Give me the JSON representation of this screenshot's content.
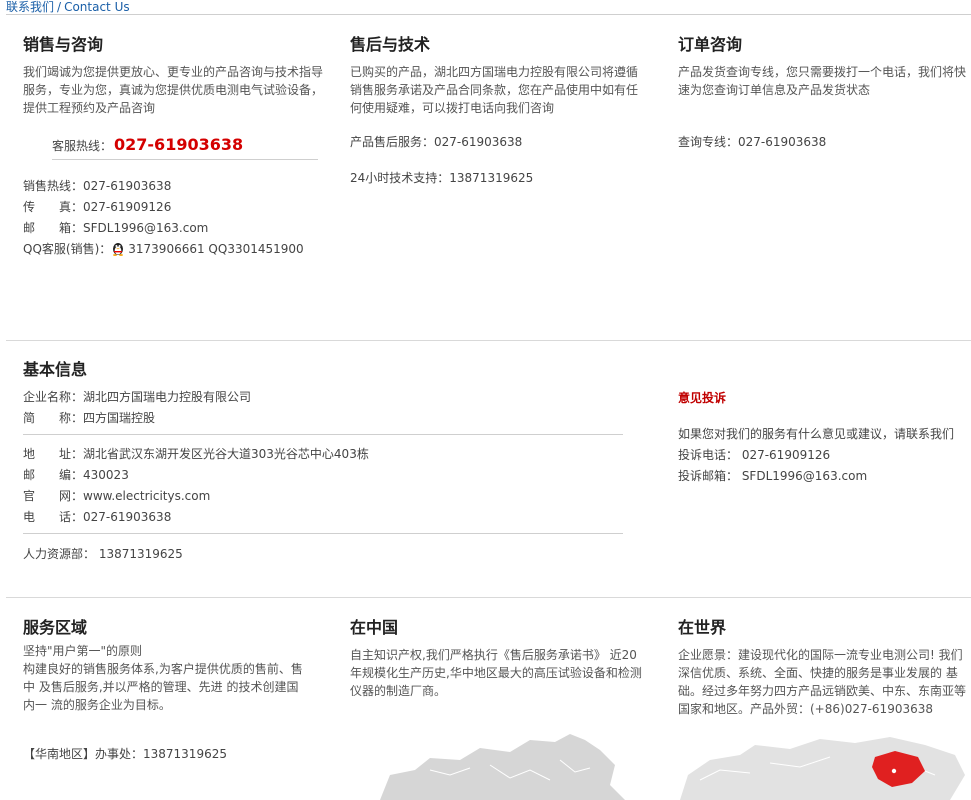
{
  "breadcrumb": {
    "cn": "联系我们",
    "sep": "/",
    "en": "Contact Us"
  },
  "sales": {
    "title": "销售与咨询",
    "desc": "我们竭诚为您提供更放心、更专业的产品咨询与技术指导服务，专业为您，真诚为您提供优质电测电气试验设备，提供工程预约及产品咨询",
    "hotline_label": "客服热线：",
    "hotline_number": "027-61903638",
    "rows": [
      {
        "label": "销售热线：",
        "value": "027-61903638"
      },
      {
        "label": "传　　真：",
        "value": "027-61909126"
      },
      {
        "label": "邮　　箱：",
        "value": "SFDL1996@163.com"
      },
      {
        "label": "QQ客服(销售)：",
        "value": "3173906661 QQ3301451900"
      }
    ]
  },
  "after_sales": {
    "title": "售后与技术",
    "desc": "已购买的产品，湖北四方国瑞电力控股有限公司将遵循销售服务承诺及产品合同条款，您在产品使用中如有任何使用疑难，可以拨打电话向我们咨询",
    "service": "产品售后服务：027-61903638",
    "support": "24小时技术支持：13871319625"
  },
  "order": {
    "title": "订单咨询",
    "desc": "产品发货查询专线，您只需要拨打一个电话，我们将快速为您查询订单信息及产品发货状态",
    "line": "查询专线：027-61903638"
  },
  "basic": {
    "title": "基本信息",
    "company": "企业名称：湖北四方国瑞电力控股有限公司",
    "short": "简　　称：四方国瑞控股",
    "rows": [
      {
        "label": "地　　址：",
        "value": "湖北省武汉东湖开发区光谷大道303光谷芯中心403栋"
      },
      {
        "label": "邮　　编：",
        "value": "430023"
      },
      {
        "label": "官　　网：",
        "value": "www.electricitys.com"
      },
      {
        "label": "电　　话：",
        "value": "027-61903638"
      }
    ],
    "hr": "人力资源部： 13871319625"
  },
  "complaint": {
    "title": "意见投诉",
    "desc": "如果您对我们的服务有什么意见或建议，请联系我们",
    "phone": "投诉电话： 027-61909126",
    "email": "投诉邮箱： SFDL1996@163.com"
  },
  "service_area": {
    "title": "服务区域",
    "line1": "坚持\"用户第一\"的原则",
    "desc": "构建良好的销售服务体系,为客户提供优质的售前、售中 及售后服务,并以严格的管理、先进 的技术创建国内一 流的服务企业为目标。",
    "office": "【华南地区】办事处：13871319625"
  },
  "china": {
    "title": "在中国",
    "desc": "自主知识产权,我们严格执行《售后服务承诺书》 近20年规模化生产历史,华中地区最大的高压试验设备和检测仪器的制造厂商。"
  },
  "world": {
    "title": "在世界",
    "desc": "企业愿景：建设现代化的国际一流专业电测公司! 我们深信优质、系统、全面、快捷的服务是事业发展的 基础。经过多年努力四方产品远销欧美、中东、东南亚等国家和地区。产品外贸：(+86)027-61903638"
  },
  "colors": {
    "accent_red": "#d40000",
    "link_blue": "#1a5fa8",
    "highlight_china": "#e02020"
  },
  "icons": {
    "qq": "qq-penguin-icon"
  }
}
